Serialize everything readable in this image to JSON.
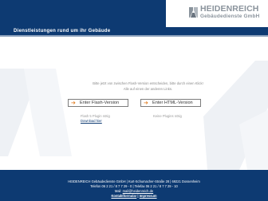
{
  "header": {
    "company_name": "HEIDENREICH",
    "company_sub": "Gebäudedienste GmbH",
    "tagline": "Dienstleistungen rund um ihr Gebäude"
  },
  "main": {
    "intro_line1": "Bitte jetzt von zwischen Flash-Version entscheiden, bitte durch einen Klick!",
    "intro_line2": "Alle auf einen der anderen Links.",
    "flash_button": "Enter Flash-Version",
    "html_button": "Enter HTML-Version",
    "flash_note": "Flash 5 Plugin nötig",
    "flash_download": "Download hier",
    "html_note": "Keine Plugins nötig"
  },
  "footer": {
    "line1": "HEIDENREICH Gebäudedienste GmbH | Kurt-Schumacher-Straße 28 | 69221 Dossenheim",
    "line2": "Telefon 06 2 21 / 8 7 7 29 - 0 | Telefax 06 2 21 / 8 7 7 29 - 10",
    "mail_label": "Mail:",
    "mail_value": "mail@heidenreich.de",
    "contact_link": "Kontaktformular",
    "separator": "|",
    "imprint_link": "Impressum"
  },
  "colors": {
    "brand_blue": "#0d3a72",
    "accent_orange": "#e07a1c",
    "logo_gray": "#8a939c"
  },
  "icons": {
    "arrow": "arrow-right-icon",
    "logo": "company-logo-mark"
  }
}
